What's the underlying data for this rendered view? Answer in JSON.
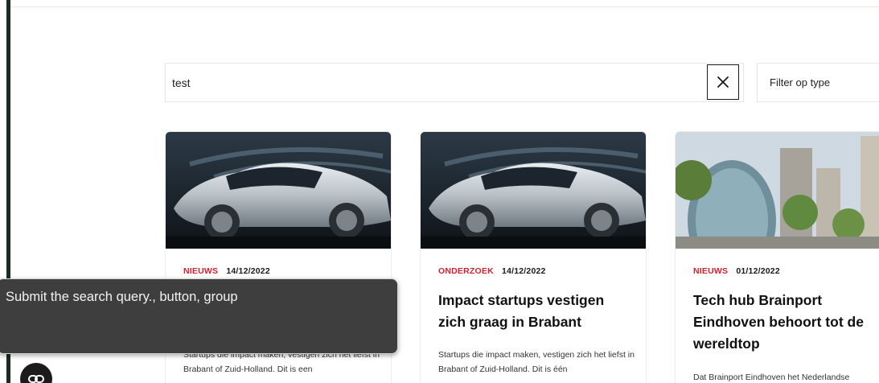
{
  "search": {
    "value": "test",
    "clear_icon": "close-icon",
    "filter_label": "Filter op type"
  },
  "cards": [
    {
      "category": "NIEUWS",
      "date": "14/12/2022",
      "title": "",
      "excerpt": "Startups die impact maken, vestigen zich het liefst in Brabant of Zuid-Holland. Dit is een",
      "image": "silver-solar-car-photo"
    },
    {
      "category": "ONDERZOEK",
      "date": "14/12/2022",
      "title": "Impact startups vestigen zich graag in Brabant",
      "excerpt": "Startups die impact maken, vestigen zich het liefst in Brabant of Zuid-Holland. Dit is één",
      "image": "silver-solar-car-photo"
    },
    {
      "category": "NIEUWS",
      "date": "01/12/2022",
      "title": "Tech hub Brainport Eindhoven behoort tot de wereldtop",
      "excerpt": "Dat Brainport Eindhoven het Nederlandse",
      "image": "eindhoven-skyline-photo"
    }
  ],
  "tooltip": {
    "text": "Submit the search query., button, group"
  },
  "floating_button": {
    "icon": "link-icon"
  },
  "colors": {
    "category_red": "#d6202f",
    "rail_green": "#1c2b24",
    "tooltip_bg": "#3e3e3e"
  }
}
